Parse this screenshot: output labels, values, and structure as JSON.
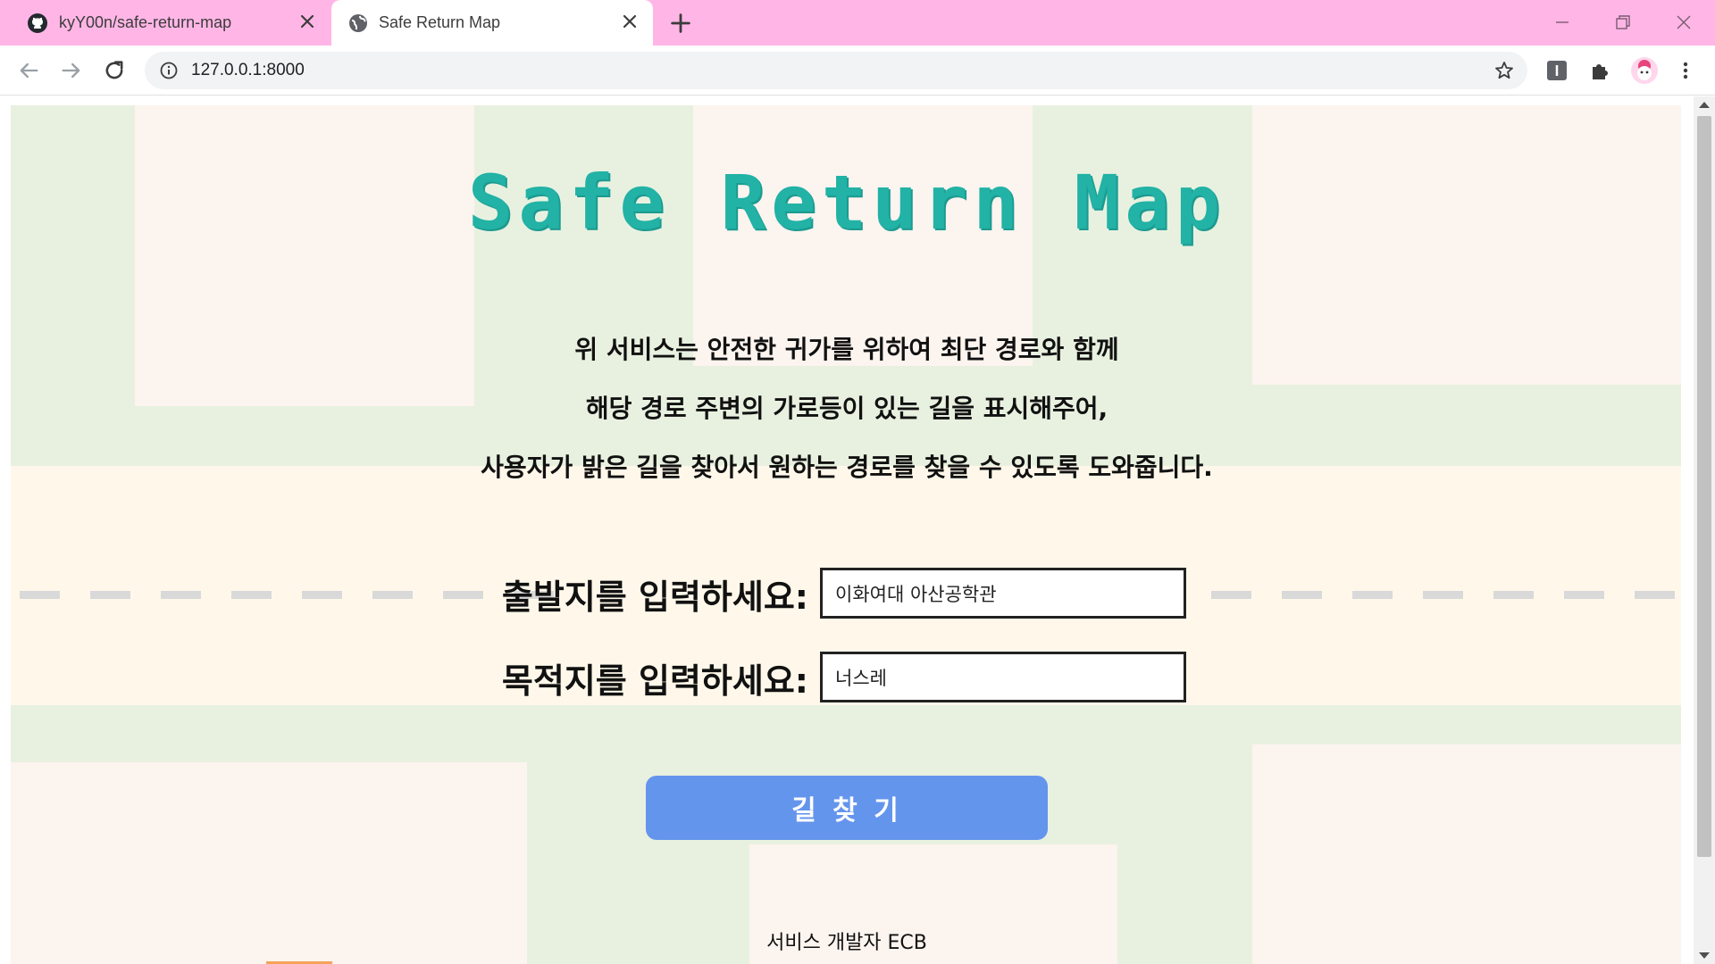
{
  "browser": {
    "tabs": [
      {
        "title": "kyY00n/safe-return-map",
        "favicon": "github-icon",
        "active": false
      },
      {
        "title": "Safe Return Map",
        "favicon": "globe-icon",
        "active": true
      }
    ],
    "url": "127.0.0.1:8000",
    "tabbar_color": "#ffb6e6"
  },
  "page": {
    "title": "Safe Return Map",
    "description": [
      "위 서비스는 안전한 귀가를 위하여 최단 경로와 함께",
      "해당 경로 주변의 가로등이 있는 길을 표시해주어,",
      "사용자가 밝은 길을 찾아서 원하는 경로를 찾을 수 있도록 도와줍니다."
    ],
    "form": {
      "origin_label": "출발지를 입력하세요:",
      "origin_value": "이화여대 아산공학관",
      "destination_label": "목적지를 입력하세요:",
      "destination_value": "너스레",
      "submit_label": "길 찾 기"
    },
    "footer": "서비스 개발자 ECB",
    "colors": {
      "title": "#22b2a6",
      "button": "#6495ed",
      "map_green": "#e8f1e0",
      "map_pink": "#fcf4ef",
      "map_cream": "#fff8ea"
    }
  }
}
